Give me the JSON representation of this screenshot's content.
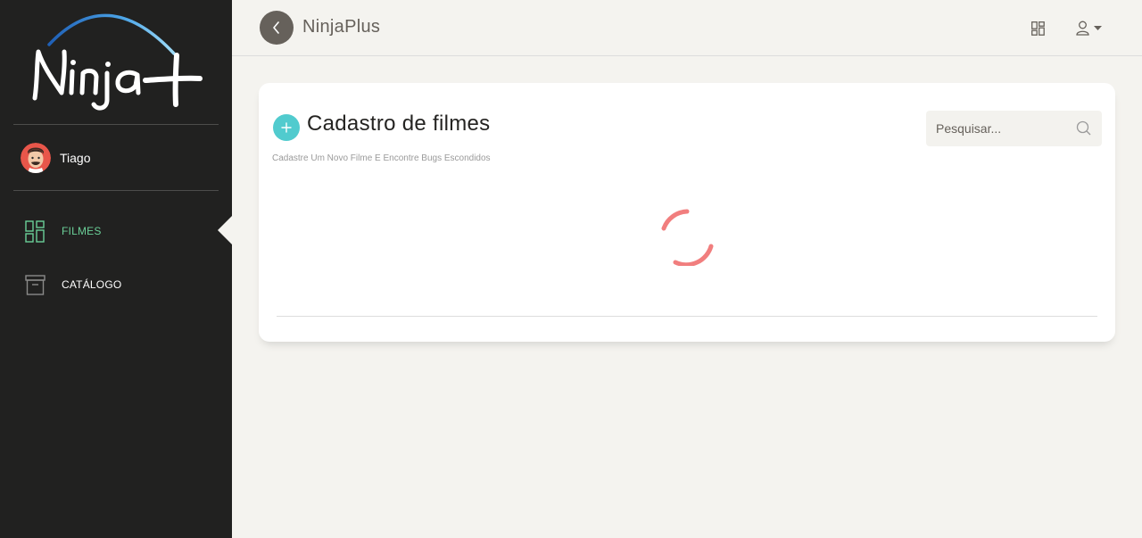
{
  "sidebar": {
    "logo_text": "Ninja+",
    "user": {
      "name": "Tiago"
    },
    "items": [
      {
        "label": "FILMES",
        "icon": "dashboard-icon",
        "active": true
      },
      {
        "label": "CATÁLOGO",
        "icon": "archive-icon",
        "active": false
      }
    ]
  },
  "header": {
    "title": "NinjaPlus",
    "icons": [
      "back-arrow-icon",
      "grid-icon",
      "user-icon",
      "caret-down-icon"
    ]
  },
  "main": {
    "title": "Cadastro de filmes",
    "subtitle": "Cadastre Um Novo Filme E Encontre Bugs Escondidos",
    "search": {
      "placeholder": "Pesquisar..."
    },
    "loading": true
  },
  "colors": {
    "sidebar_bg": "#212120",
    "page_bg": "#f4f3ef",
    "accent_green": "#6bd098",
    "accent_cyan": "#51cbce",
    "spinner_red": "#f17e7e",
    "back_button": "#66615b"
  }
}
